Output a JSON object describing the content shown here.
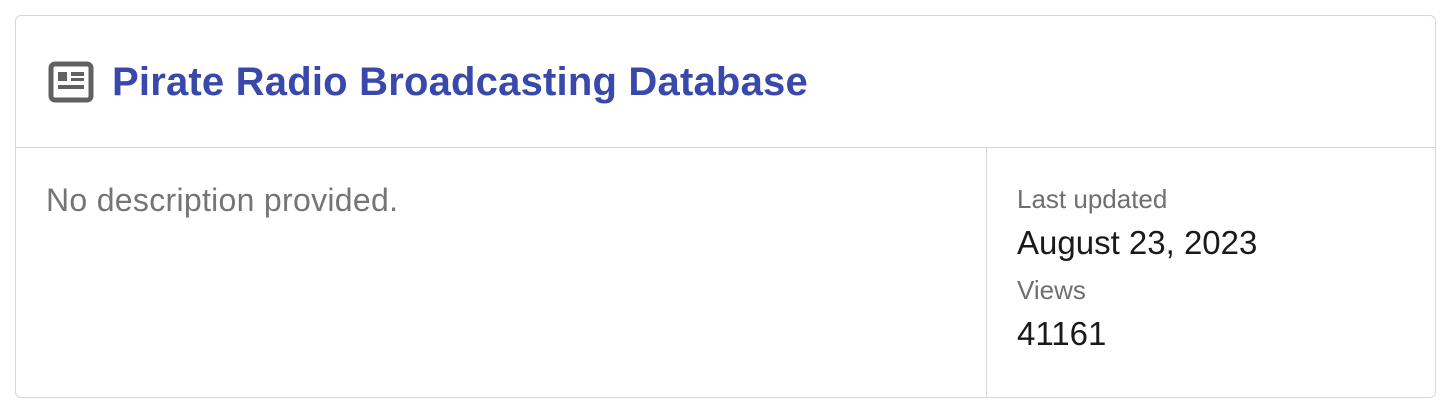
{
  "card": {
    "title": "Pirate Radio Broadcasting Database",
    "icon": "article-icon",
    "description": "No description provided.",
    "meta": {
      "last_updated_label": "Last updated",
      "last_updated_value": "August 23, 2023",
      "views_label": "Views",
      "views_value": "41161"
    }
  },
  "colors": {
    "title": "#3949ab",
    "icon": "#616161",
    "border": "#d6d6d6",
    "muted_text": "#757575"
  }
}
